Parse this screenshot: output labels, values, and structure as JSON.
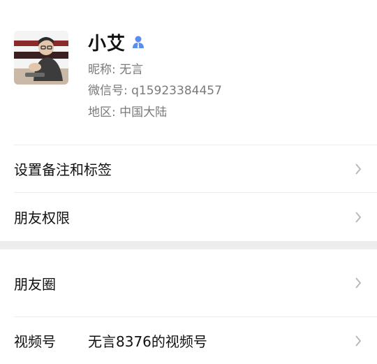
{
  "profile": {
    "name": "小艾",
    "nickname": "昵称: 无言",
    "wechat_id": "微信号: q15923384457",
    "region": "地区: 中国大陆",
    "accent_color": "#5b8def"
  },
  "menu": {
    "remark_label": "设置备注和标签",
    "permissions_label": "朋友权限",
    "moments_label": "朋友圈",
    "channels_label": "视频号",
    "channels_value": "无言8376的视频号"
  },
  "icons": {
    "back": "chevron-left-icon",
    "verified": "person-icon",
    "row_arrow": "chevron-right-icon"
  }
}
